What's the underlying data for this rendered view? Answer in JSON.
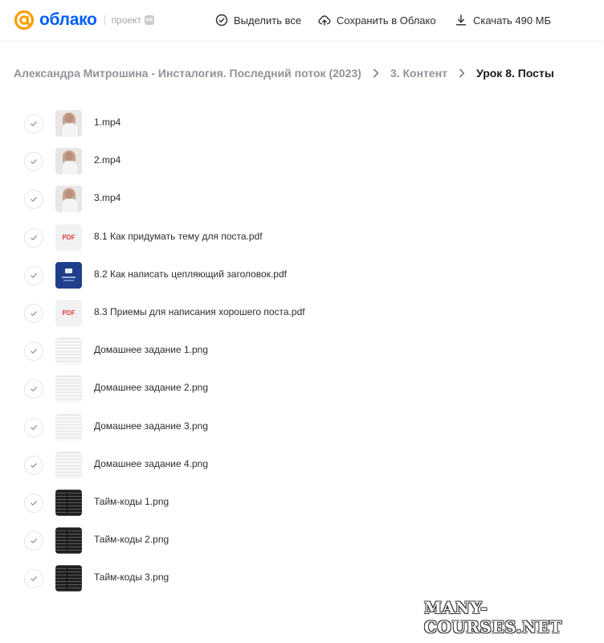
{
  "header": {
    "logo_text": "облако",
    "project_label": "проект",
    "vk_badge": "VK",
    "select_all": "Выделить все",
    "save_to_cloud": "Сохранить в Облако",
    "download": "Скачать 490 МБ"
  },
  "breadcrumb": {
    "items": [
      "Александра Митрошина - Инсталогия. Последний поток (2023)",
      "3. Контент",
      "Урок 8. Посты"
    ]
  },
  "files": [
    {
      "name": "1.mp4",
      "thumb": "video"
    },
    {
      "name": "2.mp4",
      "thumb": "video"
    },
    {
      "name": "3.mp4",
      "thumb": "video"
    },
    {
      "name": "8.1 Как придумать тему для поста.pdf",
      "thumb": "pdf",
      "thumb_label": "PDF"
    },
    {
      "name": "8.2 Как написать цепляющий заголовок.pdf",
      "thumb": "dark-pdf"
    },
    {
      "name": "8.3 Приемы для написания хорошего поста.pdf",
      "thumb": "pdf",
      "thumb_label": "PDF"
    },
    {
      "name": "Домашнее задание 1.png",
      "thumb": "doc"
    },
    {
      "name": "Домашнее задание 2.png",
      "thumb": "doc"
    },
    {
      "name": "Домашнее задание 3.png",
      "thumb": "doc"
    },
    {
      "name": "Домашнее задание 4.png",
      "thumb": "doc"
    },
    {
      "name": "Тайм-коды 1.png",
      "thumb": "code"
    },
    {
      "name": "Тайм-коды 2.png",
      "thumb": "code"
    },
    {
      "name": "Тайм-коды 3.png",
      "thumb": "code"
    }
  ],
  "watermark": {
    "text": "MANY-COURSES.NET"
  },
  "colors": {
    "brand_blue": "#005ff9",
    "brand_orange": "#ff9e00",
    "pdf_red": "#e03e3e"
  }
}
